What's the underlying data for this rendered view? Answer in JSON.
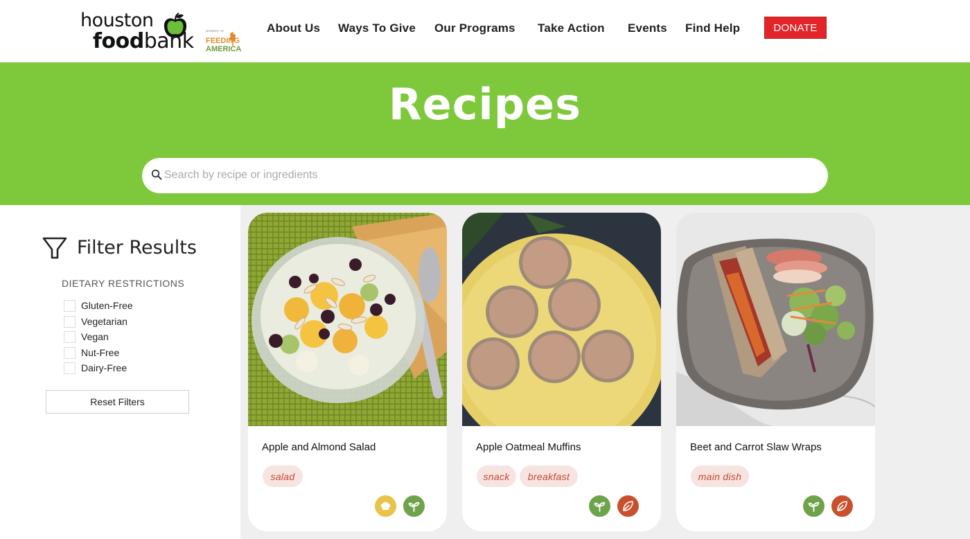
{
  "brand": {
    "line1": "houston",
    "line2_bold": "food",
    "line2_rest": "bank",
    "member_of": "MEMBER OF",
    "feeding": "FEEDING",
    "america": "AMERICA"
  },
  "nav": {
    "items": [
      "About Us",
      "Ways To Give",
      "Our Programs",
      "Take Action",
      "Events",
      "Find Help"
    ],
    "donate": "DONATE"
  },
  "hero": {
    "title": "Recipes",
    "search_placeholder": "Search by recipe or ingredients"
  },
  "filters": {
    "title": "Filter Results",
    "dietary_heading": "DIETARY RESTRICTIONS",
    "options": [
      "Gluten-Free",
      "Vegetarian",
      "Vegan",
      "Nut-Free",
      "Dairy-Free"
    ],
    "reset_label": "Reset Filters"
  },
  "recipes": [
    {
      "title": "Apple and Almond Salad",
      "tags": [
        "salad"
      ],
      "badges": [
        "chef-hat-icon",
        "sprout-icon"
      ]
    },
    {
      "title": "Apple Oatmeal Muffins",
      "tags": [
        "snack",
        "breakfast"
      ],
      "badges": [
        "sprout-icon",
        "leaf-icon"
      ]
    },
    {
      "title": "Beet and Carrot Slaw Wraps",
      "tags": [
        "main dish"
      ],
      "badges": [
        "sprout-icon",
        "leaf-icon"
      ]
    }
  ],
  "colors": {
    "brand_green": "#7ec83c",
    "donate_red": "#e3252a",
    "tag_bg": "#f7e4e1",
    "tag_text": "#c4472e",
    "badge_yellow": "#e9c44b",
    "badge_green": "#6fa34a",
    "badge_orange": "#c8502d"
  }
}
